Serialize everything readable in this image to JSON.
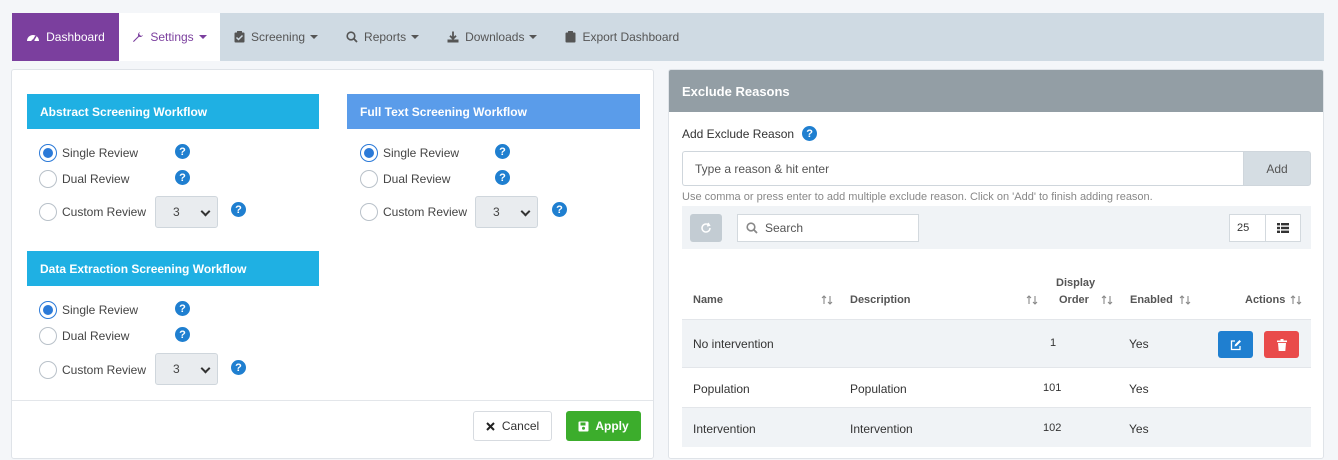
{
  "nav": {
    "dashboard": "Dashboard",
    "settings": "Settings",
    "screening": "Screening",
    "reports": "Reports",
    "downloads": "Downloads",
    "export": "Export Dashboard"
  },
  "workflows": {
    "abstract": {
      "title": "Abstract Screening Workflow",
      "single": "Single Review",
      "dual": "Dual Review",
      "custom": "Custom Review",
      "custom_value": "3",
      "selected": "single"
    },
    "fulltext": {
      "title": "Full Text Screening Workflow",
      "single": "Single Review",
      "dual": "Dual Review",
      "custom": "Custom Review",
      "custom_value": "3",
      "selected": "single"
    },
    "extraction": {
      "title": "Data Extraction Screening Workflow",
      "single": "Single Review",
      "dual": "Dual Review",
      "custom": "Custom Review",
      "custom_value": "3",
      "selected": "single"
    }
  },
  "footer": {
    "cancel": "Cancel",
    "apply": "Apply"
  },
  "exclude": {
    "title": "Exclude Reasons",
    "add_label": "Add Exclude Reason",
    "input_placeholder": "Type a reason & hit enter",
    "add_button": "Add",
    "hint": "Use comma or press enter to add multiple exclude reason. Click on 'Add' to finish adding reason.",
    "search_placeholder": "Search",
    "page_size": "25",
    "columns": {
      "name": "Name",
      "description": "Description",
      "display_order_1": "Display",
      "display_order_2": "Order",
      "enabled": "Enabled",
      "actions": "Actions"
    },
    "rows": [
      {
        "name": "No intervention",
        "description": "",
        "order": "1",
        "enabled": "Yes"
      },
      {
        "name": "Population",
        "description": "Population",
        "order": "101",
        "enabled": "Yes"
      },
      {
        "name": "Intervention",
        "description": "Intervention",
        "order": "102",
        "enabled": "Yes"
      }
    ]
  },
  "colors": {
    "nav_active": "#7b3f9e",
    "abstract_header": "#1fb0e3",
    "fulltext_header": "#5a9cea",
    "apply": "#3cad2c",
    "edit": "#1f7fd0",
    "delete": "#e94b4b"
  }
}
